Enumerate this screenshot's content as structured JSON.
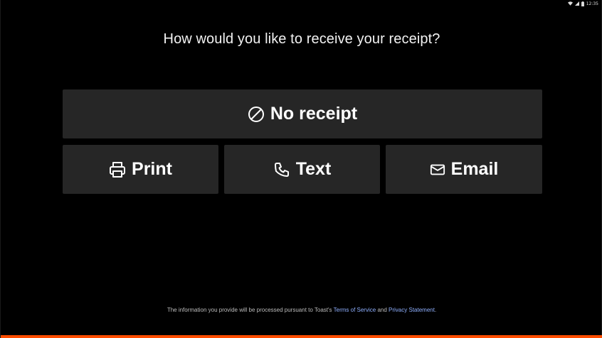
{
  "status_bar": {
    "time": "12:35",
    "icons": [
      "wifi-icon",
      "signal-icon",
      "battery-icon"
    ]
  },
  "prompt": "How would you like to receive your receipt?",
  "options": {
    "no_receipt": {
      "label": "No receipt",
      "icon": "no-entry-icon"
    },
    "print": {
      "label": "Print",
      "icon": "printer-icon"
    },
    "text": {
      "label": "Text",
      "icon": "phone-icon"
    },
    "email": {
      "label": "Email",
      "icon": "envelope-icon"
    }
  },
  "footer": {
    "prefix": "The information you provide will be processed pursuant to Toast's",
    "terms_link": "Terms of Service",
    "conjunction": "and",
    "privacy_link": "Privacy Statement",
    "suffix": "."
  },
  "colors": {
    "background": "#000000",
    "button": "#262626",
    "link": "#8fb0ff",
    "accent": "#ff4c00"
  }
}
